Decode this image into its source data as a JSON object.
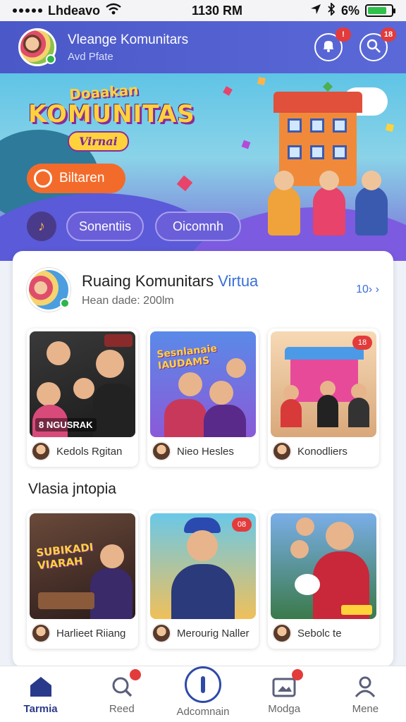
{
  "status_bar": {
    "carrier": "Lhdeavo",
    "time": "1130 RM",
    "battery": "6%"
  },
  "header": {
    "title": "Vleange Komunitars",
    "subtitle": "Avd Pfate",
    "notif_badge": "!",
    "search_badge": "18"
  },
  "hero": {
    "logo_line1": "Doaakan",
    "logo_line2": "KOMUNITAS",
    "logo_line3": "Virnai",
    "cta_label": "Biltaren",
    "pills": [
      "Sonentiis",
      "Oicomnh"
    ],
    "music_icon": "music-note-icon"
  },
  "room": {
    "title": "Ruaing Komunitars ",
    "title_accent": "Virtua",
    "subtitle": "Hean dade: 200lm",
    "count": "10› ›"
  },
  "grid1": [
    {
      "name": "Kedols Rgitan",
      "tag": "8 NGUSRAK",
      "corner": ""
    },
    {
      "name": "Nieo Hesles",
      "tag": "",
      "corner": "",
      "art": "Sesnlanaie IAUDAMS"
    },
    {
      "name": "Konodliers",
      "tag": "",
      "corner": "18"
    }
  ],
  "section_title": "Vlasia jntopia",
  "grid2": [
    {
      "name": "Harlieet Riiang",
      "tag": "",
      "corner": "",
      "art": "SUBIKADI VIARAH"
    },
    {
      "name": "Merourig Naller",
      "tag": "",
      "corner": "08"
    },
    {
      "name": "Sebolc te",
      "tag": "",
      "corner": ""
    }
  ],
  "nav": [
    {
      "label": "Tarmia",
      "icon": "home-icon"
    },
    {
      "label": "Reed",
      "icon": "search-icon"
    },
    {
      "label": "Adcomnain",
      "icon": "add-icon"
    },
    {
      "label": "Modga",
      "icon": "media-icon"
    },
    {
      "label": "Mene",
      "icon": "profile-icon"
    }
  ],
  "colors": {
    "header": "#4a58c8",
    "accent": "#3a6fd8",
    "cta": "#f36b2a",
    "badge": "#e33b3b"
  }
}
